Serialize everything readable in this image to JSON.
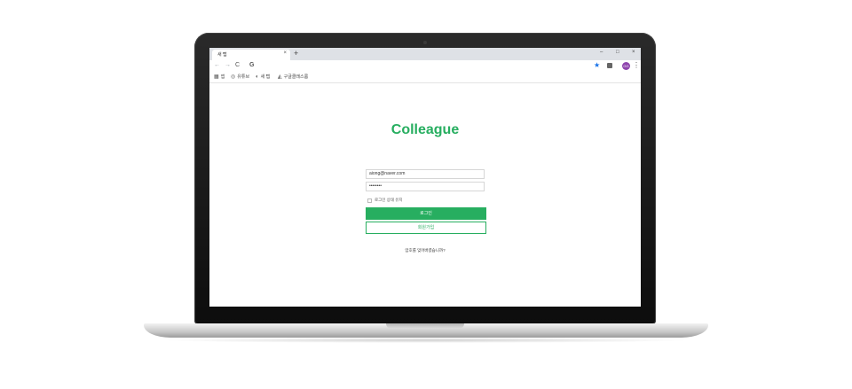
{
  "browser": {
    "tab_title": "새 탭",
    "tab_close": "×",
    "new_tab": "+",
    "window_controls": [
      "–",
      "□",
      "×"
    ],
    "nav_icons": [
      "←",
      "→",
      "C"
    ],
    "address_icon": "G",
    "profile_initials": "GG",
    "bookmarks": [
      {
        "icon": "apps-icon",
        "glyph": "▦",
        "label": "앱"
      },
      {
        "icon": "globe-icon",
        "glyph": "◎",
        "label": "유튜브"
      },
      {
        "icon": "web-icon",
        "glyph": "◐",
        "label": "새 탭"
      },
      {
        "icon": "drive-icon",
        "glyph": "◭",
        "label": "구글클래스룸"
      }
    ]
  },
  "login": {
    "title": "Colleague",
    "email_value": "aiong@naver.com",
    "password_value": "••••••••",
    "remember_label": "로그인 상태 유지",
    "login_button": "로그인",
    "signup_button": "회원가입",
    "forgot_link": "암호를 잊어버렸습니까?"
  },
  "colors": {
    "brand_green": "#27ae60",
    "profile": "#8e44ad"
  }
}
